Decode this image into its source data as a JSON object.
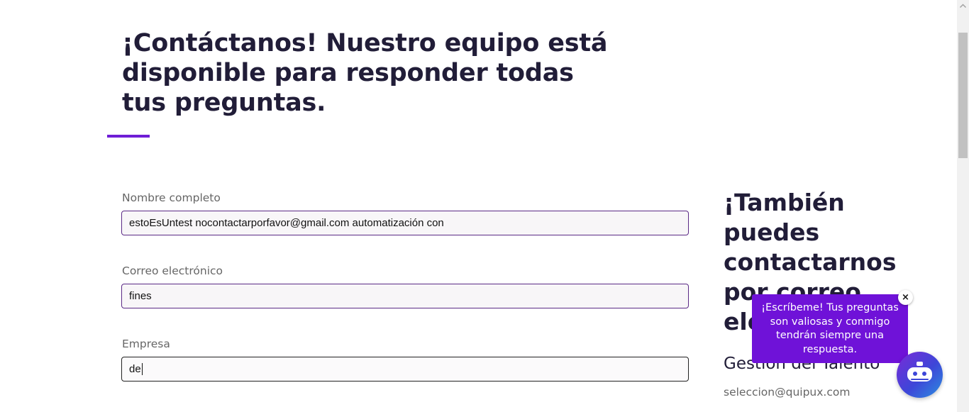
{
  "contact": {
    "headline": "¡Contáctanos! Nuestro equipo está disponible para responder todas tus preguntas."
  },
  "form": {
    "name": {
      "label": "Nombre completo",
      "value": "estoEsUntest nocontactarporfavor@gmail.com automatización con"
    },
    "email": {
      "label": "Correo electrónico",
      "value": "fines"
    },
    "company": {
      "label": "Empresa",
      "value": "de"
    }
  },
  "sidebar": {
    "title": "¡También puedes contactarnos por correo electrónico!",
    "department": "Gestión del Talento",
    "email": "seleccion@quipux.com"
  },
  "chat": {
    "message": "¡Escríbeme! Tus preguntas son valiosas y conmigo tendrán siempre una respuesta.",
    "close_symbol": "×"
  },
  "colors": {
    "accent": "#6f1dd6",
    "heading": "#211d38",
    "chat_bubble": "#6f12d8"
  },
  "icons": {
    "chat_launcher": "robot-icon",
    "close": "close-icon",
    "scroll_up": "chevron-up-icon"
  }
}
